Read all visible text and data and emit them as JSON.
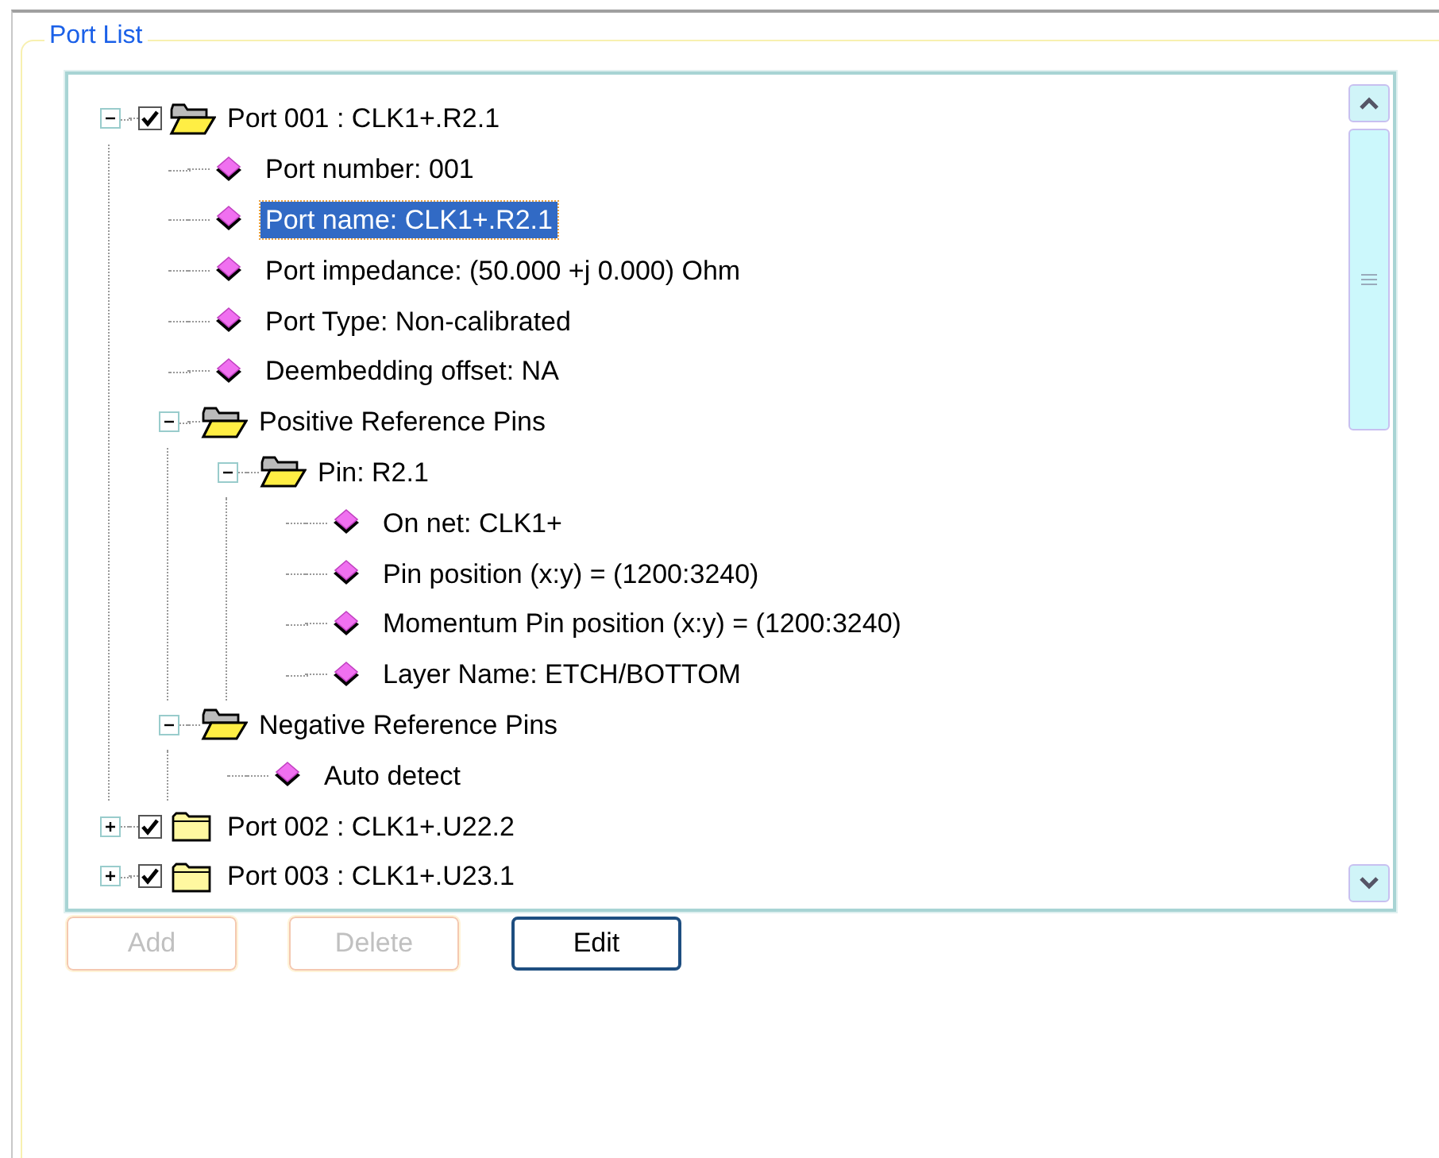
{
  "group_title": "Port List",
  "tree": [
    {
      "kind": "port",
      "label": "Port 001 : CLK1+.R2.1",
      "checked": true,
      "expanded": true,
      "selected": false,
      "children": [
        {
          "kind": "property",
          "label": "Port number: 001",
          "selected": false
        },
        {
          "kind": "property",
          "label": "Port name: CLK1+.R2.1",
          "selected": true
        },
        {
          "kind": "property",
          "label": "Port impedance: (50.000 +j 0.000) Ohm",
          "selected": false
        },
        {
          "kind": "property",
          "label": "Port Type: Non-calibrated",
          "selected": false
        },
        {
          "kind": "property",
          "label": "Deembedding offset: NA",
          "selected": false
        },
        {
          "kind": "folder",
          "label": "Positive Reference Pins",
          "expanded": true,
          "selected": false,
          "children": [
            {
              "kind": "folder",
              "label": "Pin: R2.1",
              "expanded": true,
              "selected": false,
              "children": [
                {
                  "kind": "property",
                  "label": "On net: CLK1+",
                  "selected": false
                },
                {
                  "kind": "property",
                  "label": "Pin position (x:y) = (1200:3240)",
                  "selected": false
                },
                {
                  "kind": "property",
                  "label": "Momentum Pin position (x:y) = (1200:3240)",
                  "selected": false
                },
                {
                  "kind": "property",
                  "label": "Layer Name: ETCH/BOTTOM",
                  "selected": false
                }
              ]
            }
          ]
        },
        {
          "kind": "folder",
          "label": "Negative Reference Pins",
          "expanded": true,
          "selected": false,
          "children": [
            {
              "kind": "property",
              "label": "Auto detect",
              "selected": false
            }
          ]
        }
      ]
    },
    {
      "kind": "port",
      "label": "Port 002 : CLK1+.U22.2",
      "checked": true,
      "expanded": false,
      "selected": false
    },
    {
      "kind": "port",
      "label": "Port 003 : CLK1+.U23.1",
      "checked": true,
      "expanded": false,
      "selected": false
    }
  ],
  "buttons": [
    {
      "label": "Add",
      "disabled": true
    },
    {
      "label": "Delete",
      "disabled": true
    },
    {
      "label": "Edit",
      "disabled": false
    }
  ]
}
